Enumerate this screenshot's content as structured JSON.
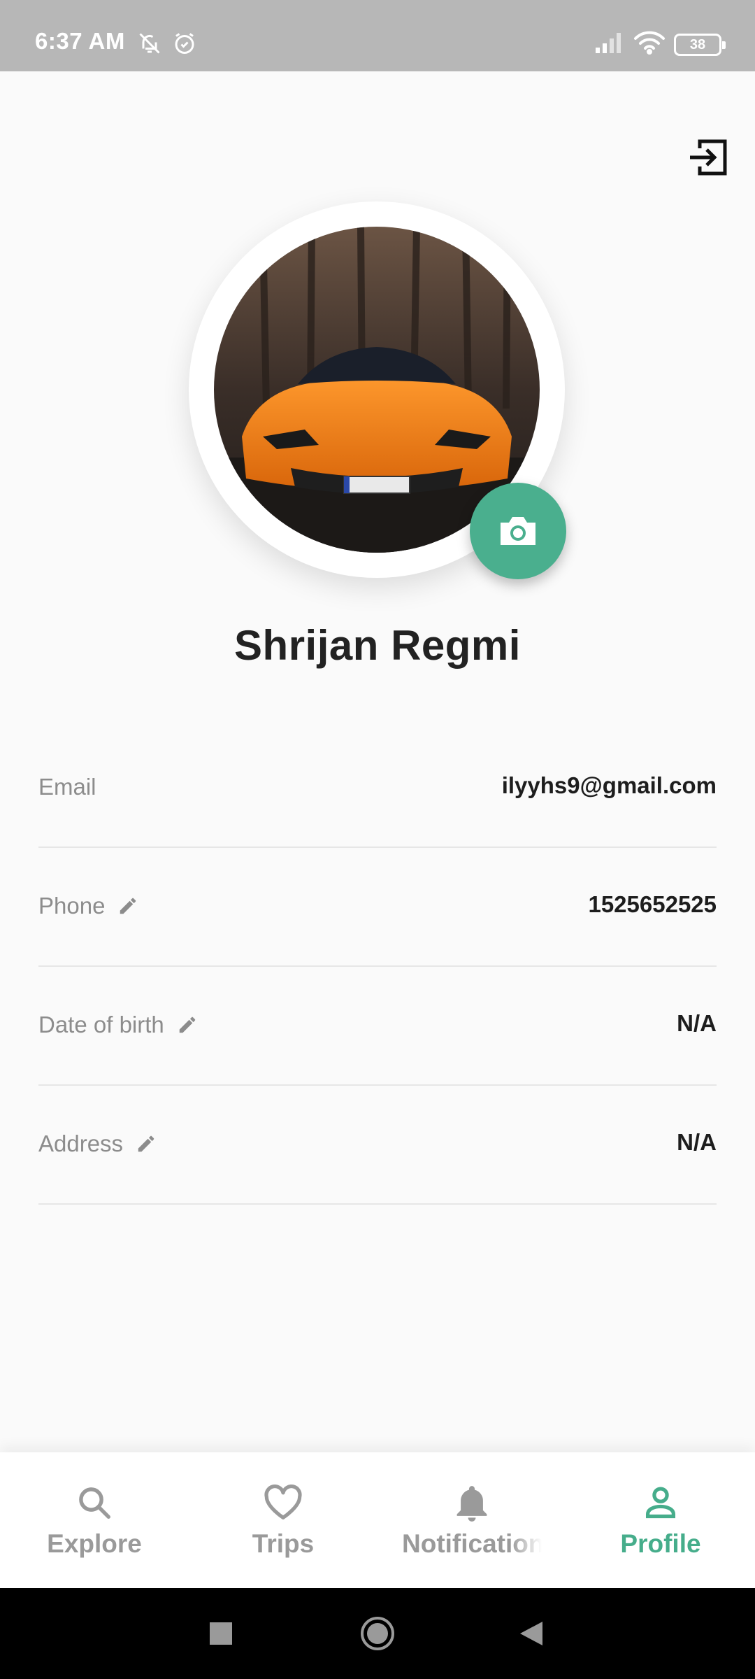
{
  "status_bar": {
    "time": "6:37 AM",
    "battery": "38"
  },
  "profile": {
    "name": "Shrijan Regmi"
  },
  "fields": [
    {
      "label": "Email",
      "value": "ilyyhs9@gmail.com"
    },
    {
      "label": "Phone",
      "value": "1525652525"
    },
    {
      "label": "Date of birth",
      "value": "N/A"
    },
    {
      "label": "Address",
      "value": "N/A"
    }
  ],
  "bottom_nav": {
    "items": [
      {
        "label": "Explore",
        "icon": "search-icon"
      },
      {
        "label": "Trips",
        "icon": "heart-icon"
      },
      {
        "label": "Notifications",
        "icon": "bell-icon"
      },
      {
        "label": "Profile",
        "icon": "person-icon"
      }
    ],
    "active_index": 3
  },
  "colors": {
    "accent": "#46ad8b",
    "status_bar": "#b7b7b7",
    "background": "#fafafa"
  }
}
